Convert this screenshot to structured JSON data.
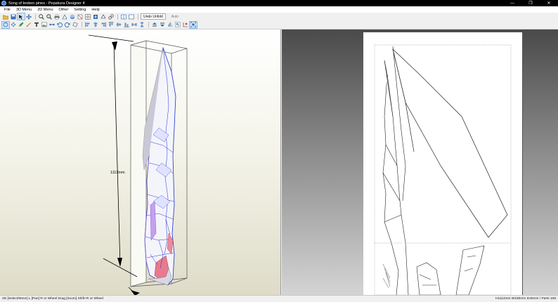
{
  "window": {
    "title": "Song of broken pines - Pepakura Designer 4",
    "controls": {
      "minimize": "—",
      "maximize": "❐",
      "close": "✕"
    }
  },
  "menu": [
    "File",
    "3D Menu",
    "2D Menu",
    "Other",
    "Setting",
    "Help"
  ],
  "toolbar": {
    "row1_icons": [
      "open-icon",
      "save-icon",
      "select-icon",
      "move-icon",
      "zoom-in-icon",
      "zoom-out-icon",
      "print-icon",
      "edges-icon",
      "texture-icon",
      "unfold-icon",
      "grid-icon",
      "settings-icon",
      "wireframe-icon",
      "link-icon"
    ],
    "layout_icons": [
      "split-view-icon",
      "single-view-icon"
    ],
    "undo_unfold_label": "Undo Unfold",
    "auto_label": "Auto",
    "row2_icons": [
      "rotate-icon",
      "pan-icon",
      "edit-icon",
      "draw-icon",
      "text-icon",
      "image-icon",
      "join-icon",
      "undo-icon",
      "redo-icon",
      "rotate-part-icon",
      "align-left-icon",
      "align-center-icon",
      "align-right-icon",
      "align-top-icon",
      "align-middle-icon",
      "align-bottom-icon",
      "distribute-h-icon",
      "distribute-v-icon",
      "layer-up-icon",
      "layer-down-icon",
      "flip-icon",
      "group-icon",
      "snap-icon",
      "fit-icon"
    ]
  },
  "view3d": {
    "dimension_label": "1112mm"
  },
  "status": {
    "left": "2D [Select/Move] L [Pan] R or Wheel Drag [Zoom] Shift+R or Wheel",
    "right": "H1112mm W180mm D40mm / Parts 108"
  }
}
